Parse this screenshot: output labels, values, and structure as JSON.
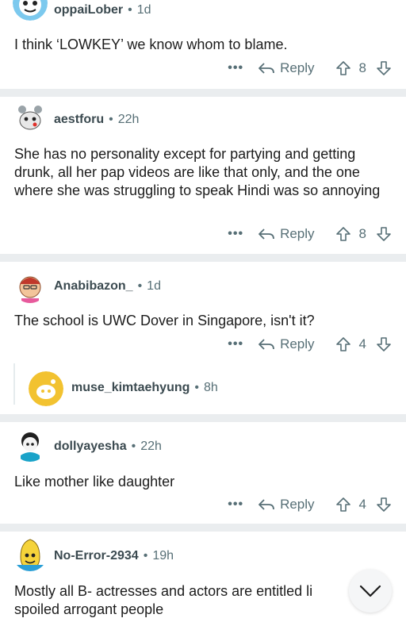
{
  "actions": {
    "more": "•••",
    "reply": "Reply"
  },
  "comments": [
    {
      "user": "oppaiLober",
      "time": "1d",
      "text": "I think ‘LOWKEY’ we know whom to blame.",
      "votes": "8"
    },
    {
      "user": "aestforu",
      "time": "22h",
      "text": "She has no personality except for partying and getting drunk, all her pap videos are like that only, and the one where she was struggling to speak Hindi was so annoying",
      "votes": "8"
    },
    {
      "user": "Anabibazon_",
      "time": "1d",
      "text": "The school is UWC Dover in Singapore, isn't it?",
      "votes": "4",
      "reply": {
        "user": "muse_kimtaehyung",
        "time": "8h"
      }
    },
    {
      "user": "dollyayesha",
      "time": "22h",
      "text": "Like mother like daughter",
      "votes": "4"
    },
    {
      "user": "No-Error-2934",
      "time": "19h",
      "text": "Mostly all B- actresses and actors are entitled li spoiled arrogant people"
    }
  ],
  "colors": {
    "separator": "#eaedef",
    "meta": "#576f76",
    "text": "#1c1c1c"
  }
}
